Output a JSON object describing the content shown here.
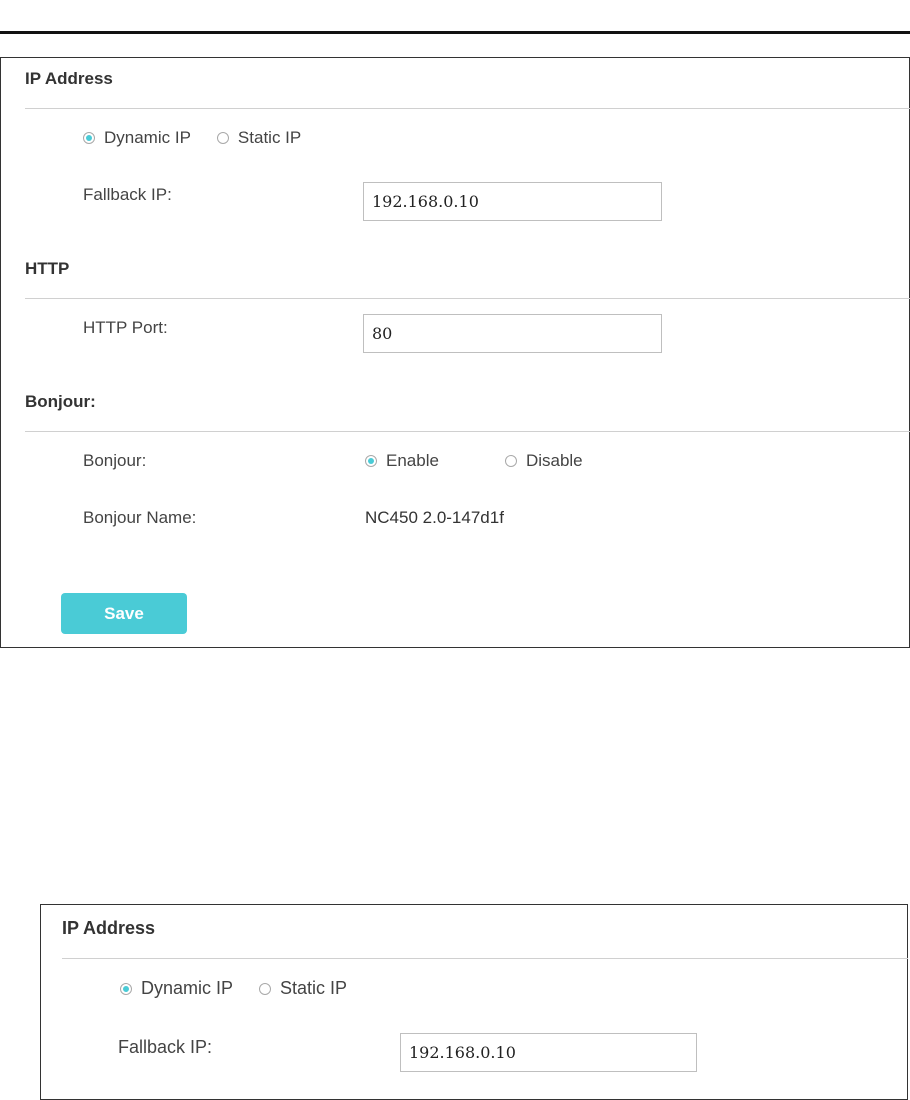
{
  "panel_full": {
    "ip_address": {
      "title": "IP Address",
      "options": [
        "Dynamic IP",
        "Static IP"
      ],
      "selected": "Dynamic IP",
      "fallback_label": "Fallback IP:",
      "fallback_value": "192.168.0.10"
    },
    "http": {
      "title": "HTTP",
      "port_label": "HTTP Port:",
      "port_value": "80"
    },
    "bonjour": {
      "title": "Bonjour:",
      "bonjour_label": "Bonjour:",
      "options": [
        "Enable",
        "Disable"
      ],
      "selected": "Enable",
      "name_label": "Bonjour Name:",
      "name_value": "NC450 2.0-147d1f"
    },
    "save_label": "Save"
  },
  "panel_zoom": {
    "title": "IP Address",
    "options": [
      "Dynamic IP",
      "Static IP"
    ],
    "selected": "Dynamic IP",
    "fallback_label": "Fallback IP:",
    "fallback_value": "192.168.0.10"
  },
  "colors": {
    "accent": "#4acbd6",
    "text": "#333333",
    "divider": "#d0d0d0",
    "top_rule": "#111111"
  }
}
